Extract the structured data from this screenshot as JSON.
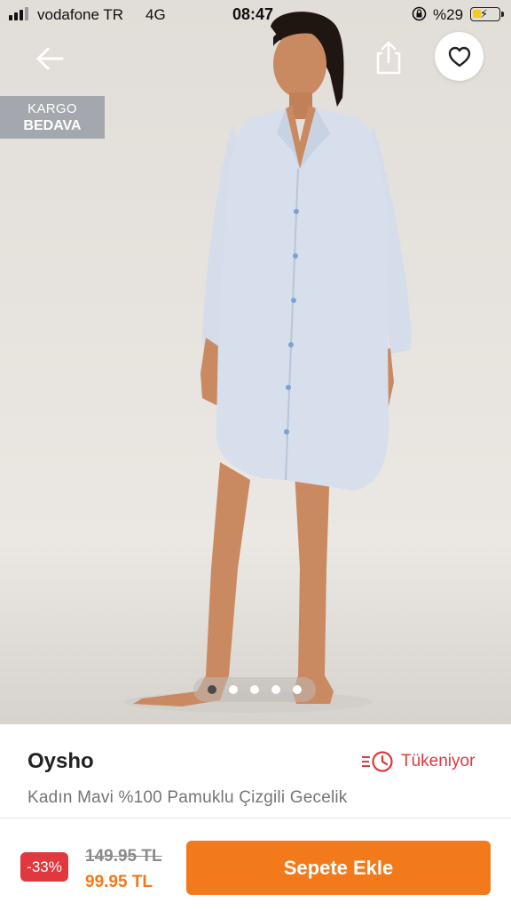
{
  "status_bar": {
    "carrier": "vodafone TR",
    "network": "4G",
    "time": "08:47",
    "battery_percent": "%29"
  },
  "header": {
    "back_icon": "arrow-left-icon",
    "share_icon": "share-icon",
    "favorite_icon": "heart-icon"
  },
  "badge": {
    "line1": "KARGO",
    "line2": "BEDAVA"
  },
  "gallery": {
    "image_count": 5,
    "active_index": 0
  },
  "product": {
    "brand": "Oysho",
    "stock_status": "Tükeniyor",
    "stock_icon": "clock-icon",
    "title": "Kadın Mavi %100 Pamuklu Çizgili Gecelik"
  },
  "price": {
    "discount": "-33%",
    "old": "149.95 TL",
    "new": "99.95 TL"
  },
  "actions": {
    "add_to_cart": "Sepete Ekle"
  },
  "colors": {
    "accent": "#f27a1a",
    "danger": "#e0383e"
  }
}
